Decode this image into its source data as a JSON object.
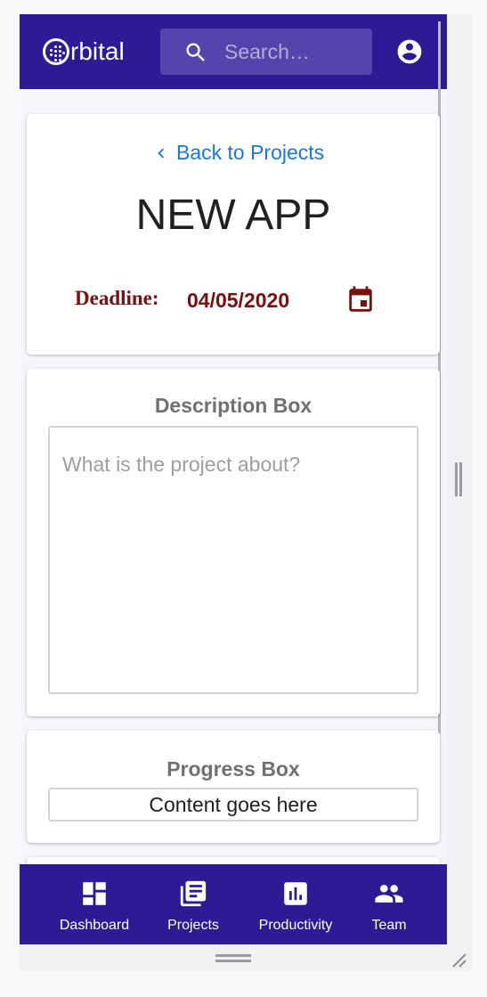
{
  "header": {
    "logo_text": "rbital",
    "search_placeholder": "Search…"
  },
  "project": {
    "back_link": "Back to Projects",
    "title": "NEW APP",
    "deadline_label": "Deadline:",
    "deadline_value": "04/05/2020"
  },
  "description_box": {
    "title": "Description Box",
    "placeholder": "What is the project about?"
  },
  "progress_box": {
    "title": "Progress Box",
    "content": "Content goes here"
  },
  "bottom_nav": {
    "items": [
      {
        "label": "Dashboard",
        "icon": "dashboard-icon"
      },
      {
        "label": "Projects",
        "icon": "projects-icon"
      },
      {
        "label": "Productivity",
        "icon": "bar-chart-icon"
      },
      {
        "label": "Team",
        "icon": "people-icon"
      }
    ]
  },
  "colors": {
    "brand": "#2e1a95",
    "link": "#1877e8",
    "deadline": "#7a0f10"
  }
}
